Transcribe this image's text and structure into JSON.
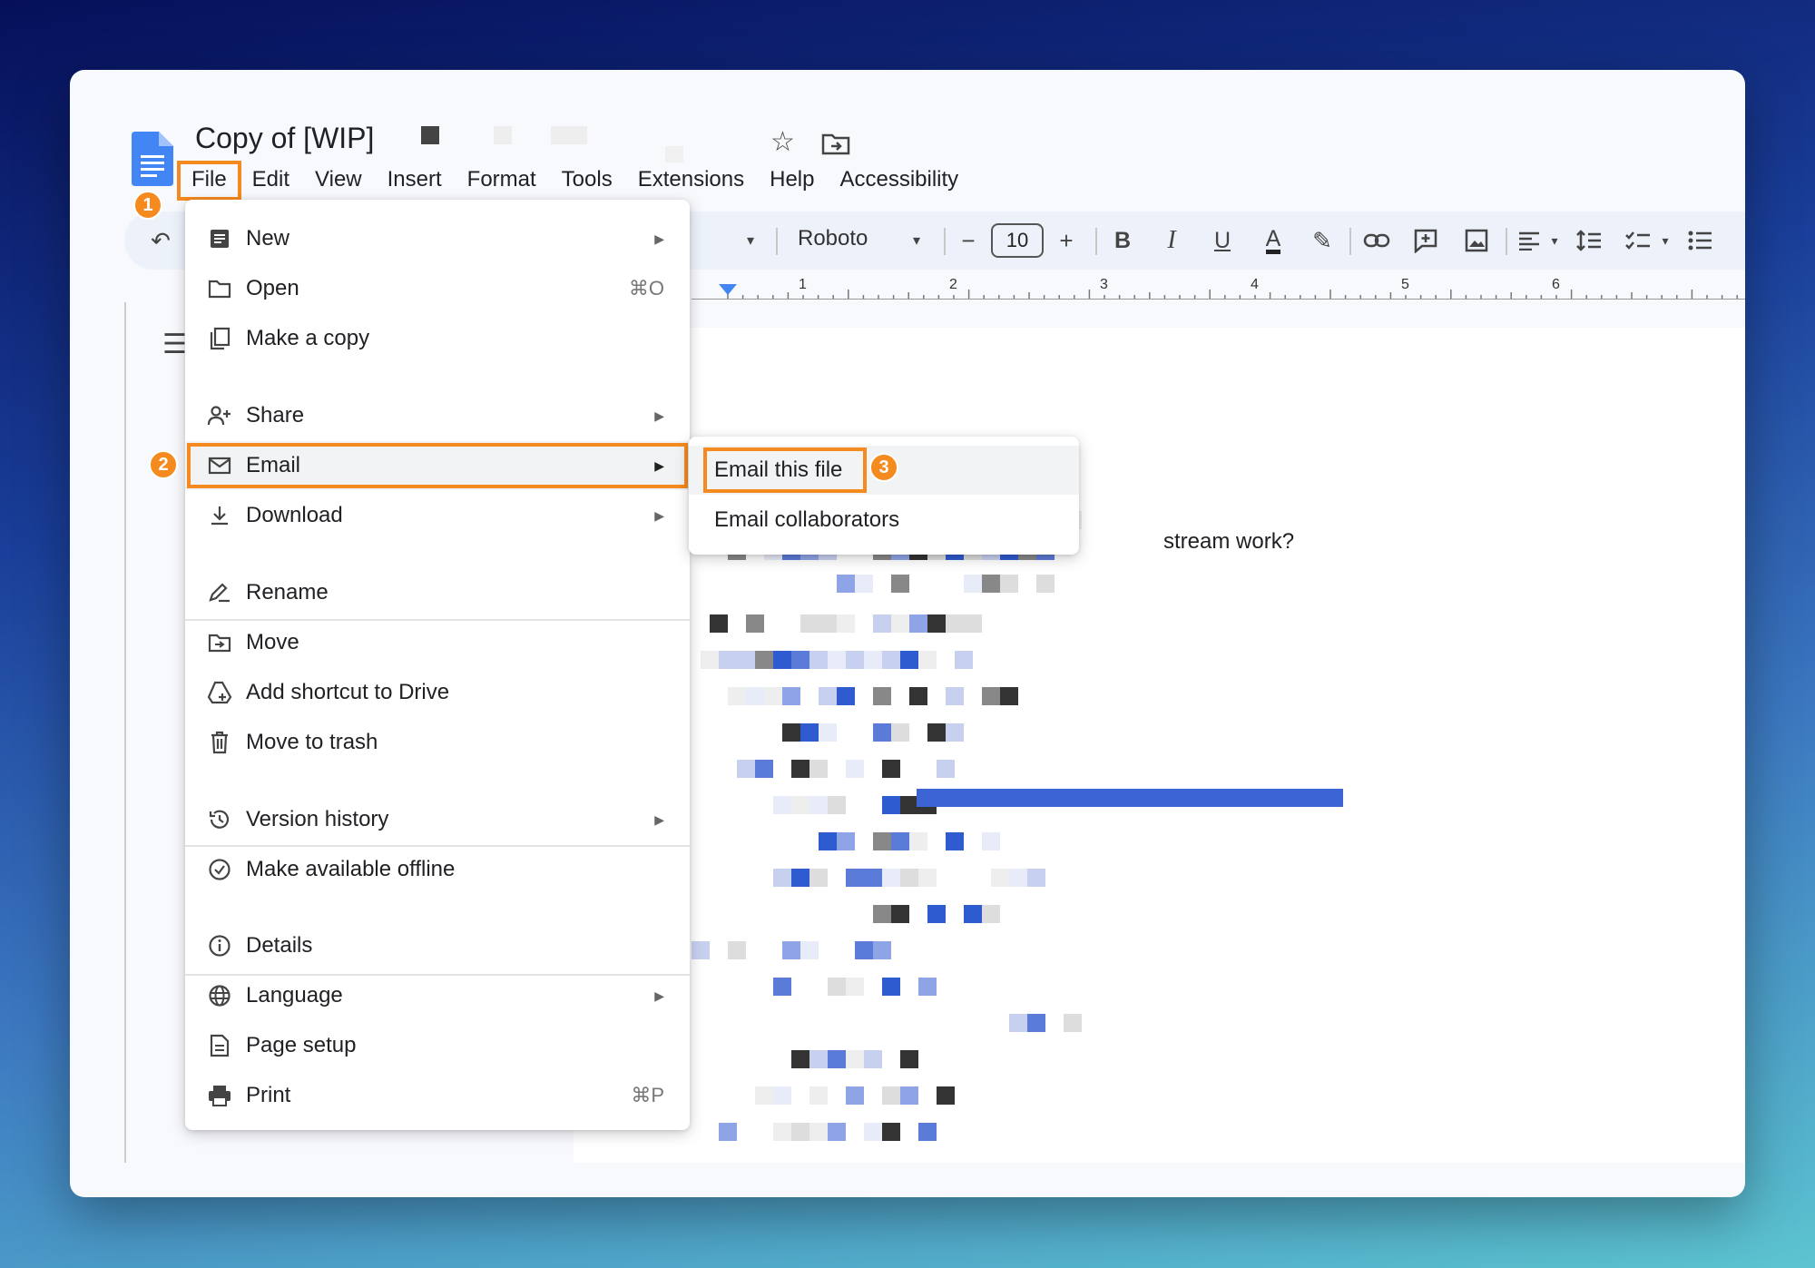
{
  "document": {
    "title": "Copy of [WIP]",
    "visible_text_fragment": "stream work?"
  },
  "menubar": {
    "items": [
      "File",
      "Edit",
      "View",
      "Insert",
      "Format",
      "Tools",
      "Extensions",
      "Help",
      "Accessibility"
    ]
  },
  "toolbar": {
    "font": "Roboto",
    "font_size": "10"
  },
  "ruler": {
    "numbers": [
      "1",
      "2",
      "3",
      "4",
      "5",
      "6"
    ]
  },
  "badges": [
    "1",
    "2",
    "3"
  ],
  "file_menu": {
    "group1": [
      {
        "label": "New",
        "icon": "new-doc-icon",
        "has_submenu": true
      },
      {
        "label": "Open",
        "icon": "folder-icon",
        "shortcut": "⌘O"
      },
      {
        "label": "Make a copy",
        "icon": "copy-icon"
      }
    ],
    "group2": [
      {
        "label": "Share",
        "icon": "share-person-icon",
        "has_submenu": true
      },
      {
        "label": "Email",
        "icon": "mail-icon",
        "has_submenu": true
      },
      {
        "label": "Download",
        "icon": "download-icon",
        "has_submenu": true
      }
    ],
    "group3": [
      {
        "label": "Rename",
        "icon": "rename-icon"
      },
      {
        "label": "Move",
        "icon": "move-folder-icon"
      },
      {
        "label": "Add shortcut to Drive",
        "icon": "drive-shortcut-icon"
      },
      {
        "label": "Move to trash",
        "icon": "trash-icon"
      }
    ],
    "group4": [
      {
        "label": "Version history",
        "icon": "history-icon",
        "has_submenu": true
      },
      {
        "label": "Make available offline",
        "icon": "offline-check-icon"
      }
    ],
    "group5": [
      {
        "label": "Details",
        "icon": "info-icon"
      },
      {
        "label": "Language",
        "icon": "globe-icon",
        "has_submenu": true
      },
      {
        "label": "Page setup",
        "icon": "page-setup-icon"
      },
      {
        "label": "Print",
        "icon": "print-icon",
        "shortcut": "⌘P"
      }
    ]
  },
  "email_submenu": {
    "items": [
      "Email this file",
      "Email collaborators"
    ]
  },
  "colors": {
    "highlight": "#f58a1f",
    "docs_blue": "#4285f4"
  }
}
